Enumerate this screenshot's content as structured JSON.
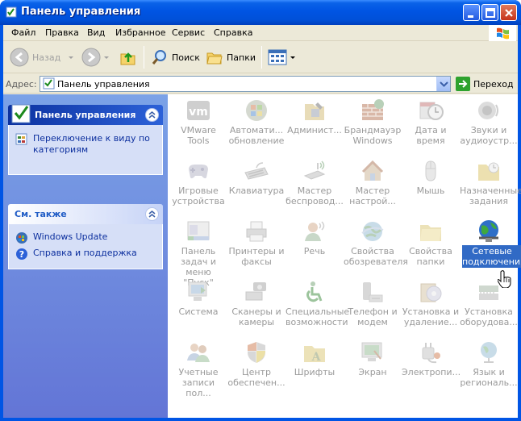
{
  "window": {
    "title": "Панель управления"
  },
  "menubar": {
    "items": [
      {
        "label": "Файл"
      },
      {
        "label": "Правка"
      },
      {
        "label": "Вид"
      },
      {
        "label": "Избранное"
      },
      {
        "label": "Сервис"
      },
      {
        "label": "Справка"
      }
    ]
  },
  "toolbar": {
    "back_label": "Назад",
    "search_label": "Поиск",
    "folders_label": "Папки"
  },
  "addressbar": {
    "label": "Адрес:",
    "value": "Панель управления",
    "go_label": "Переход"
  },
  "leftpane": {
    "control_panel": {
      "title": "Панель управления",
      "task": "Переключение к виду по категориям"
    },
    "see_also": {
      "title": "См. также",
      "links": [
        {
          "label": "Windows Update"
        },
        {
          "label": "Справка и поддержка"
        }
      ]
    }
  },
  "items": [
    {
      "label": "VMware Tools",
      "icon": "vmware-icon"
    },
    {
      "label": "Автомати... обновление",
      "icon": "automatic-updates-icon"
    },
    {
      "label": "Админист...",
      "icon": "administrative-tools-icon"
    },
    {
      "label": "Брандмауэр Windows",
      "icon": "firewall-icon"
    },
    {
      "label": "Дата и время",
      "icon": "date-time-icon"
    },
    {
      "label": "Звуки и аудиоустр...",
      "icon": "sounds-icon"
    },
    {
      "label": "Игровые устройства",
      "icon": "game-controllers-icon"
    },
    {
      "label": "Клавиатура",
      "icon": "keyboard-icon"
    },
    {
      "label": "Мастер беспровод...",
      "icon": "wireless-wizard-icon"
    },
    {
      "label": "Мастер настрой...",
      "icon": "network-wizard-icon"
    },
    {
      "label": "Мышь",
      "icon": "mouse-icon"
    },
    {
      "label": "Назначенные задания",
      "icon": "scheduled-tasks-icon"
    },
    {
      "label": "Панель задач и меню \"Пуск\"",
      "icon": "taskbar-icon"
    },
    {
      "label": "Принтеры и факсы",
      "icon": "printers-icon"
    },
    {
      "label": "Речь",
      "icon": "speech-icon"
    },
    {
      "label": "Свойства обозревателя",
      "icon": "internet-options-icon"
    },
    {
      "label": "Свойства папки",
      "icon": "folder-options-icon"
    },
    {
      "label": "Сетевые подключения",
      "icon": "network-connections-icon",
      "selected": true
    },
    {
      "label": "Система",
      "icon": "system-icon"
    },
    {
      "label": "Сканеры и камеры",
      "icon": "scanners-icon"
    },
    {
      "label": "Специальные возможности",
      "icon": "accessibility-icon"
    },
    {
      "label": "Телефон и модем",
      "icon": "phone-modem-icon"
    },
    {
      "label": "Установка и удаление...",
      "icon": "add-remove-programs-icon"
    },
    {
      "label": "Установка оборудова...",
      "icon": "add-hardware-icon"
    },
    {
      "label": "Учетные записи пол...",
      "icon": "user-accounts-icon"
    },
    {
      "label": "Центр обеспечен...",
      "icon": "security-center-icon"
    },
    {
      "label": "Шрифты",
      "icon": "fonts-icon"
    },
    {
      "label": "Экран",
      "icon": "display-icon"
    },
    {
      "label": "Электропи...",
      "icon": "power-options-icon"
    },
    {
      "label": "Язык и региональ...",
      "icon": "regional-options-icon"
    }
  ],
  "colors": {
    "titlebar": "#0054e3",
    "selection": "#316ac5",
    "link": "#0c2f9e",
    "disabled_text": "#9a9a9a"
  }
}
